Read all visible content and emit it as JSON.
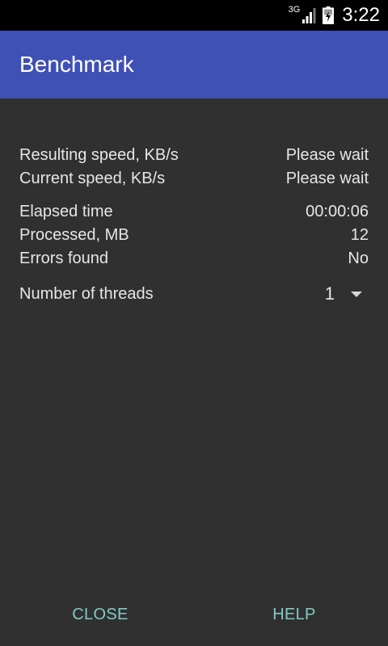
{
  "status_bar": {
    "network": "3G",
    "time": "3:22",
    "icons": [
      "signal-icon",
      "battery-charging-icon"
    ]
  },
  "app_bar": {
    "title": "Benchmark",
    "color": "#3f51b5"
  },
  "stats": {
    "resulting_speed": {
      "label": "Resulting speed, KB/s",
      "value": "Please wait"
    },
    "current_speed": {
      "label": "Current speed, KB/s",
      "value": "Please wait"
    },
    "elapsed_time": {
      "label": "Elapsed time",
      "value": "00:00:06"
    },
    "processed": {
      "label": "Processed, MB",
      "value": "12"
    },
    "errors": {
      "label": "Errors found",
      "value": "No"
    }
  },
  "threads": {
    "label": "Number of threads",
    "selected": "1"
  },
  "footer": {
    "close_label": "CLOSE",
    "help_label": "HELP",
    "accent": "#80cbc4"
  }
}
